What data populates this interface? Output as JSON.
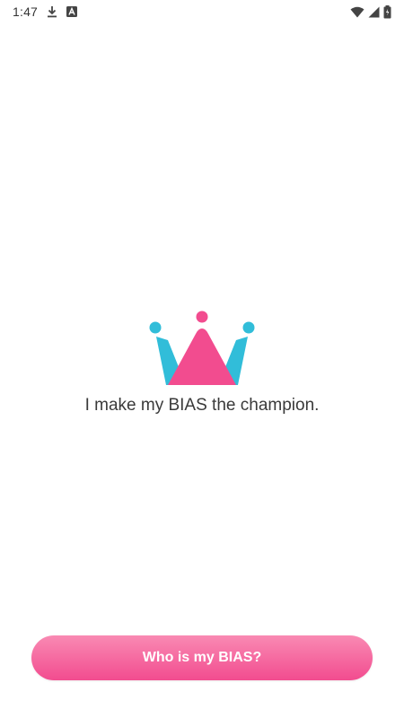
{
  "status_bar": {
    "time": "1:47",
    "left_icons": [
      "download-icon",
      "a-notification-icon"
    ],
    "right_icons": [
      "wifi-icon",
      "signal-icon",
      "battery-icon"
    ]
  },
  "hero": {
    "logo": "crown-logo",
    "tagline": "I make my BIAS the champion."
  },
  "cta": {
    "label": "Who is my BIAS?"
  },
  "colors": {
    "pink": "#f24c8f",
    "pink_light": "#f98ab3",
    "cyan": "#31bdd9",
    "text": "#3a3a3a"
  }
}
